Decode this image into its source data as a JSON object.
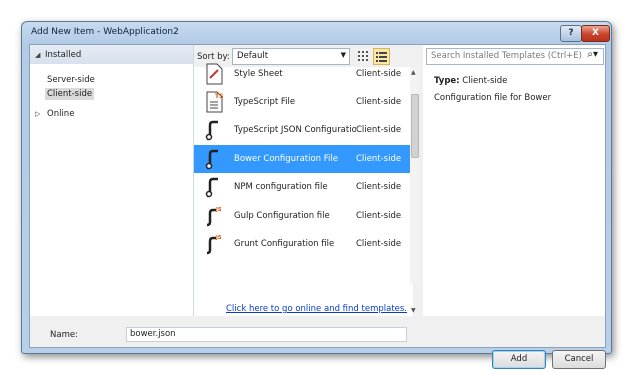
{
  "window": {
    "title": "Add New Item - WebApplication2",
    "help_label": "?",
    "close_label": "X"
  },
  "tree": {
    "header": "Installed",
    "children": [
      "Server-side",
      "Client-side"
    ],
    "online": "Online"
  },
  "sort": {
    "label": "Sort by:",
    "value": "Default"
  },
  "items": [
    {
      "name": "Style Sheet",
      "category": "Client-side"
    },
    {
      "name": "TypeScript File",
      "category": "Client-side"
    },
    {
      "name": "TypeScript JSON Configuratio...",
      "category": "Client-side"
    },
    {
      "name": "Bower Configuration File",
      "category": "Client-side"
    },
    {
      "name": "NPM configuration file",
      "category": "Client-side"
    },
    {
      "name": "Gulp Configuration file",
      "category": "Client-side"
    },
    {
      "name": "Grunt Configuration file",
      "category": "Client-side"
    }
  ],
  "online_link": "Click here to go online and find templates.",
  "search": {
    "placeholder": "Search Installed Templates (Ctrl+E)"
  },
  "details": {
    "type_label": "Type:",
    "type_value": "Client-side",
    "description": "Configuration file for Bower"
  },
  "name_field": {
    "label": "Name:",
    "value": "bower.json"
  },
  "buttons": {
    "add": "Add",
    "cancel": "Cancel"
  },
  "colors": {
    "selection": "#3399ff",
    "link": "#0a3cc8"
  }
}
